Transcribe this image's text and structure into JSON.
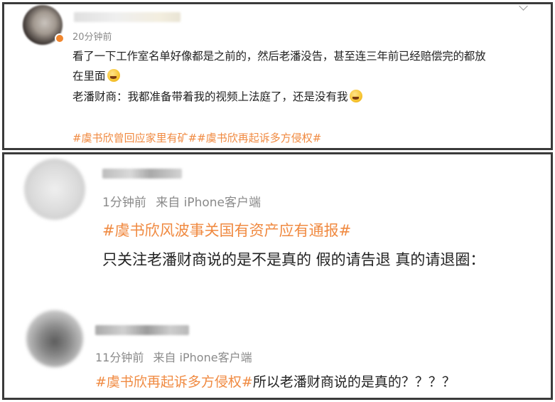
{
  "comment_1": {
    "time": "20分钟前",
    "text_line1": "看了一下工作室名单好像都是之前的，然后老潘没告，甚至连三年前已经赔偿完的都放",
    "text_line2": "在里面",
    "text_line3": "老潘财商：我都准备带着我的视频上法庭了，还是没有我",
    "hashtags": "#虞书欣曾回应家里有矿##虞书欣再起诉多方侵权#",
    "emoji_1": "laugh-cry-emoji",
    "emoji_2": "grin-sweat-emoji",
    "verified_color": "#f0862e"
  },
  "comment_2": {
    "time": "1分钟前",
    "source": "来自 iPhone客户端",
    "hashtag": "#虞书欣风波事关国有资产应有通报#",
    "text": "只关注老潘财商说的是不是真的 假的请告退 真的请退圈："
  },
  "comment_3": {
    "time": "11分钟前",
    "source": "来自 iPhone客户端",
    "hashtag": "#虞书欣再起诉多方侵权#",
    "text": "所以老潘财商说的是真的？？？？"
  },
  "colors": {
    "tag": "#f08a41",
    "meta": "#8a8a8a",
    "border": "#3a3a3a"
  }
}
